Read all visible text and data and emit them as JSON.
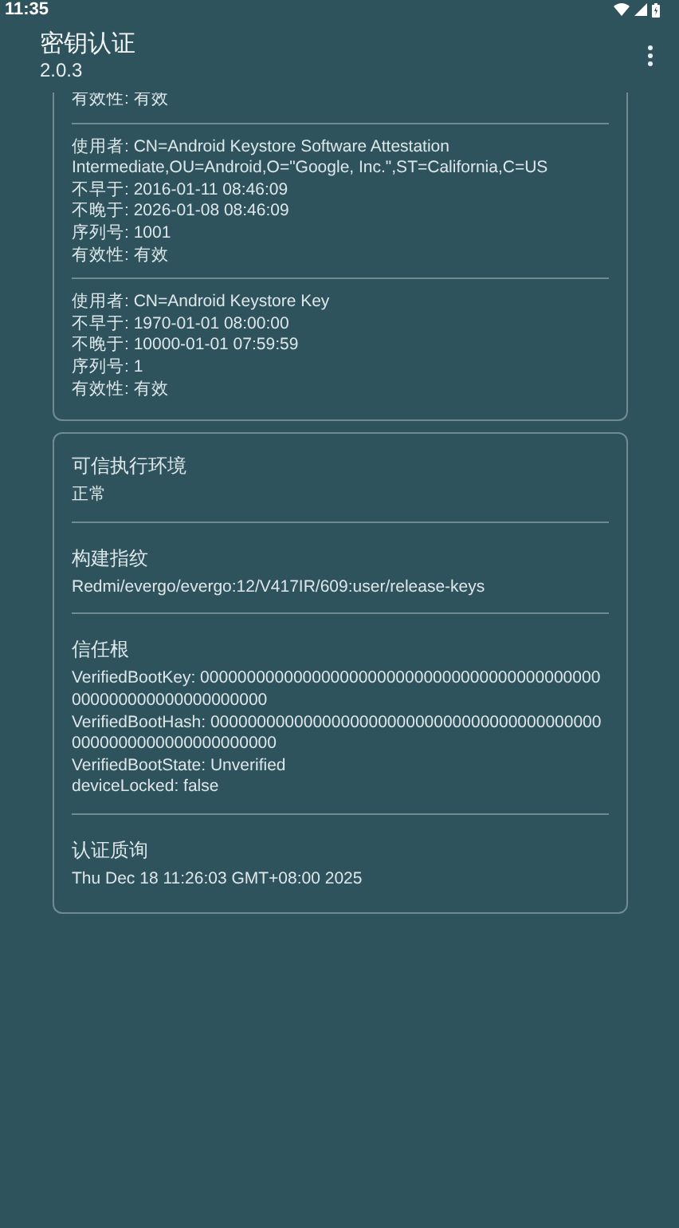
{
  "status_bar": {
    "time": "11:35"
  },
  "app_bar": {
    "title": "密钥认证",
    "subtitle": "2.0.3"
  },
  "certificate_card": {
    "certificates": [
      {
        "lines": [
          "有效性: 有效"
        ]
      },
      {
        "lines": [
          "使用者: CN=Android Keystore Software Attestation Intermediate,OU=Android,O=\"Google, Inc.\",ST=California,C=US",
          "不早于: 2016-01-11 08:46:09",
          "不晚于: 2026-01-08 08:46:09",
          "序列号: 1001",
          "有效性: 有效"
        ]
      },
      {
        "lines": [
          "使用者: CN=Android Keystore Key",
          "不早于: 1970-01-01 08:00:00",
          "不晚于: 10000-01-01 07:59:59",
          "序列号: 1",
          "有效性: 有效"
        ]
      }
    ]
  },
  "info_card": {
    "sections": [
      {
        "title": "可信执行环境",
        "lines": [
          "正常"
        ]
      },
      {
        "title": "构建指纹",
        "lines": [
          "Redmi/evergo/evergo:12/V417IR/609:user/release-keys"
        ]
      },
      {
        "title": "信任根",
        "lines": [
          "VerifiedBootKey: 0000000000000000000000000000000000000000000000000000000000000000",
          "VerifiedBootHash: 0000000000000000000000000000000000000000000000000000000000000000",
          "VerifiedBootState: Unverified",
          "deviceLocked: false"
        ]
      },
      {
        "title": "认证质询",
        "lines": [
          "Thu Dec 18 11:26:03 GMT+08:00 2025"
        ]
      }
    ]
  }
}
